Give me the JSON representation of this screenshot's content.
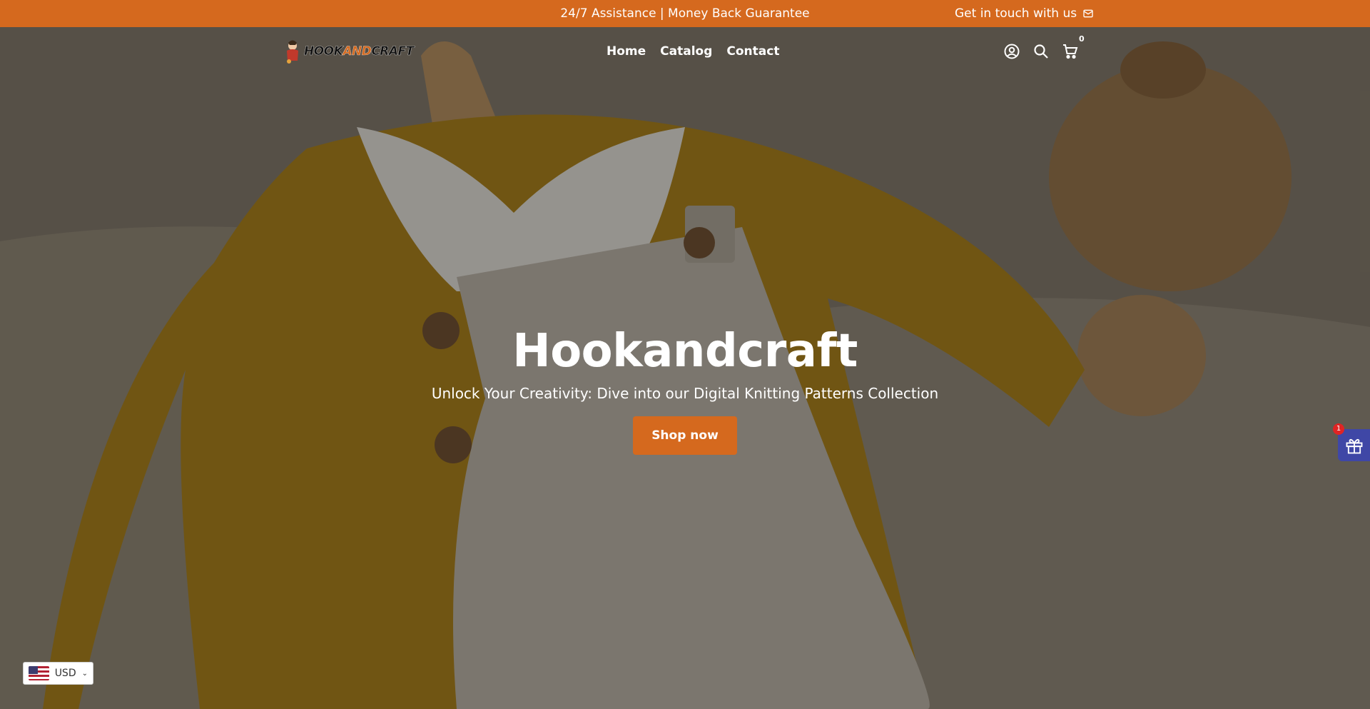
{
  "announcement": {
    "text": "24/7 Assistance | Money Back Guarantee",
    "contact_label": "Get in touch with us"
  },
  "header": {
    "logo_left": "HOOK",
    "logo_mid": "AND",
    "logo_right": "CRAFT",
    "nav": [
      "Home",
      "Catalog",
      "Contact"
    ],
    "cart_count": "0"
  },
  "hero": {
    "title": "Hookandcraft",
    "subtitle": "Unlock Your Creativity: Dive into our Digital Knitting Patterns Collection",
    "cta": "Shop now"
  },
  "widgets": {
    "gift_badge": "1",
    "currency": "USD"
  },
  "colors": {
    "accent": "#d5691e",
    "gift": "#3f47a6"
  },
  "icons": [
    "mail-icon",
    "account-icon",
    "search-icon",
    "cart-icon",
    "gift-icon",
    "us-flag-icon",
    "chevron-down-icon"
  ]
}
